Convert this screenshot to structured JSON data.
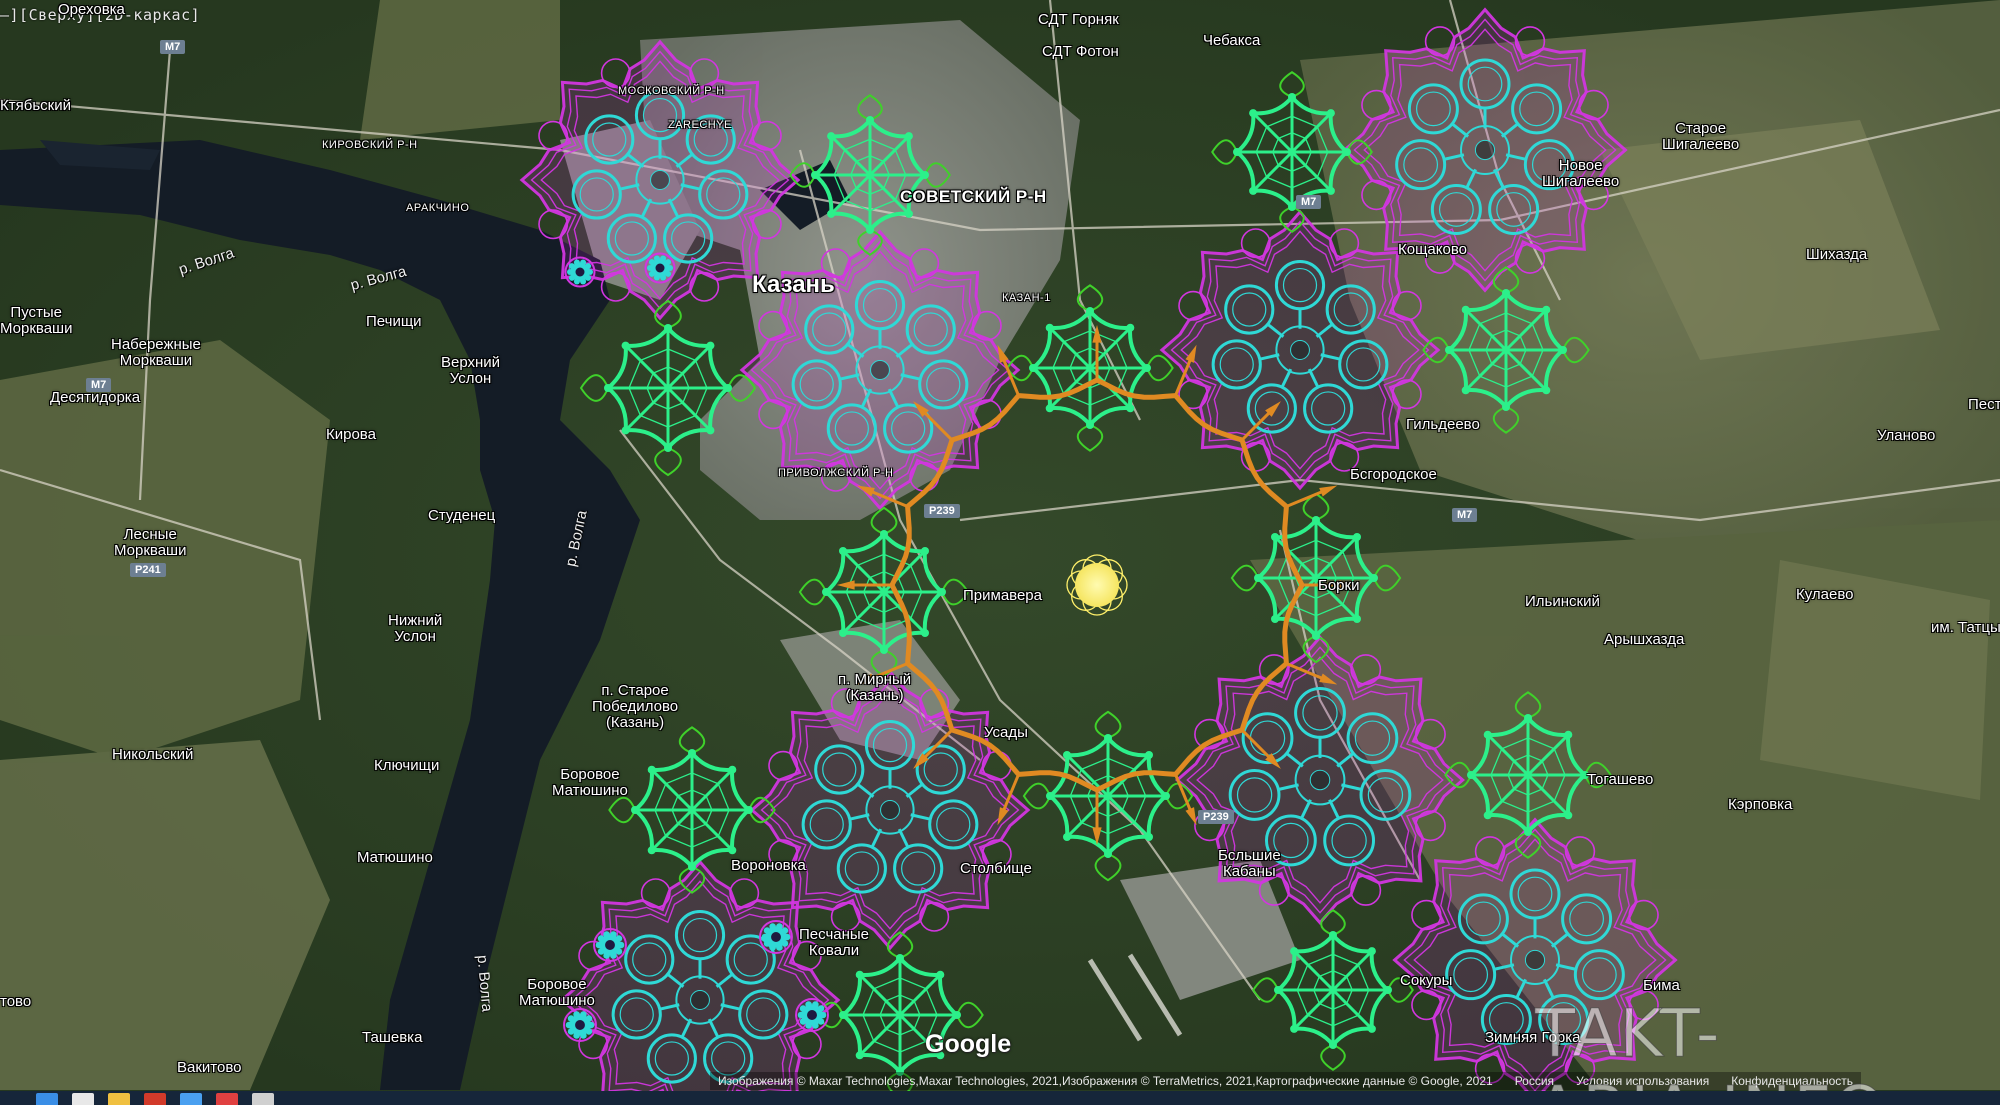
{
  "window": {
    "title": "—][Сверху][2D-каркас]"
  },
  "colors": {
    "water": "#141c26",
    "forest": "#2c4024",
    "field": "#6d7452",
    "urban": "#8b8f8c",
    "magenta": "#d236e0",
    "cyan": "#2fd9d6",
    "green": "#2cf08a",
    "lime": "#3fd12a",
    "orange": "#e08a22",
    "sun": "#fff06a"
  },
  "map": {
    "places": [
      {
        "name": "place-orekhovka",
        "text": "Ореховка"
      },
      {
        "name": "place-kstovo",
        "text": "Ктябьский"
      },
      {
        "name": "place-sdt-gornyak",
        "text": "СДТ Горняк"
      },
      {
        "name": "place-sdt-foton",
        "text": "СДТ Фотон"
      },
      {
        "name": "place-chebaksa",
        "text": "Чебакса"
      },
      {
        "name": "place-moskovsky",
        "text": "МОСКОВСКИЙ Р-Н"
      },
      {
        "name": "place-zarechye",
        "text": "ZARECHYE"
      },
      {
        "name": "place-kirovsky",
        "text": "КИРОВСКИЙ Р-Н"
      },
      {
        "name": "place-arakchino",
        "text": "АРАКЧИНО"
      },
      {
        "name": "place-sovetsky",
        "text": "СОВЕТСКИЙ Р-Н"
      },
      {
        "name": "place-staroe-shigalevo",
        "text": "Старое\nШигалеево"
      },
      {
        "name": "place-novoe-shigalevo",
        "text": "Новое\nШигалеево"
      },
      {
        "name": "place-koshchakovo",
        "text": "Кощаково"
      },
      {
        "name": "place-shikhazda",
        "text": "Шихазда"
      },
      {
        "name": "place-kazan",
        "text": "Казань"
      },
      {
        "name": "place-kazan-1",
        "text": "КАЗАН-1"
      },
      {
        "name": "place-pustye-morkvashi",
        "text": "Пустые\nМоркваши"
      },
      {
        "name": "place-pechishchi",
        "text": "Печищи"
      },
      {
        "name": "place-naberezhnye-morkvashi",
        "text": "Набережные\nМоркваши"
      },
      {
        "name": "place-verkhny-uslon",
        "text": "Верхний\nУслон"
      },
      {
        "name": "place-desyatidorka",
        "text": "Десятидорка"
      },
      {
        "name": "place-kirova",
        "text": "Кирова"
      },
      {
        "name": "place-gildeevo",
        "text": "Гильдеево"
      },
      {
        "name": "place-ulanovo",
        "text": "Уланово"
      },
      {
        "name": "place-pest",
        "text": "Пест"
      },
      {
        "name": "place-privolzhsky",
        "text": "ПРИВОЛЖСКИЙ Р-Н"
      },
      {
        "name": "place-bogorodskoe",
        "text": "Бсгородское"
      },
      {
        "name": "place-studenets",
        "text": "Студенец"
      },
      {
        "name": "place-lesnye-morkvashi",
        "text": "Лесные\nМоркваши"
      },
      {
        "name": "place-primavera",
        "text": "Примавера"
      },
      {
        "name": "place-borki",
        "text": "Борки"
      },
      {
        "name": "place-ilinsky",
        "text": "Ильинский"
      },
      {
        "name": "place-kulaevo",
        "text": "Кулаево"
      },
      {
        "name": "place-tattsy",
        "text": "им. Татцы"
      },
      {
        "name": "place-nizhny-uslon",
        "text": "Нижний\nУслон"
      },
      {
        "name": "place-arysh-khazda",
        "text": "Арышхазда"
      },
      {
        "name": "place-mirny",
        "text": "п. Мирный\n(Казань)"
      },
      {
        "name": "place-staroe-pobedilovo",
        "text": "п. Старое\nПобедилово\n(Казань)"
      },
      {
        "name": "place-usady",
        "text": "Усады"
      },
      {
        "name": "place-nikolsky",
        "text": "Никольский"
      },
      {
        "name": "place-klyuchishchi",
        "text": "Ключищи"
      },
      {
        "name": "place-borovoe-matyushino-1",
        "text": "Боровое\nМатюшино"
      },
      {
        "name": "place-togashevo",
        "text": "Тогашево"
      },
      {
        "name": "place-karpovka",
        "text": "Кэрповка"
      },
      {
        "name": "place-bolshie-kabany",
        "text": "Бсльшие\nКабаны"
      },
      {
        "name": "place-stolbishche",
        "text": "Столбище"
      },
      {
        "name": "place-voronovka",
        "text": "Вороновка"
      },
      {
        "name": "place-matyushino",
        "text": "Матюшино"
      },
      {
        "name": "place-pesчаные-kovali",
        "text": "Песчаные\nКовали"
      },
      {
        "name": "place-borovoe-matyushino-2",
        "text": "Боровое\nМатюшино"
      },
      {
        "name": "place-sokury",
        "text": "Сокуры"
      },
      {
        "name": "place-bima",
        "text": "Бима"
      },
      {
        "name": "place-tovo",
        "text": "тово"
      },
      {
        "name": "place-tashevka",
        "text": "Ташевка"
      },
      {
        "name": "place-vakitovo",
        "text": "Вакитово"
      },
      {
        "name": "place-zimnyaya-gorka",
        "text": "Зимняя Горка"
      }
    ],
    "rivers": [
      {
        "name": "river-label-1",
        "text": "р. Волга"
      },
      {
        "name": "river-label-2",
        "text": "р. Волга"
      },
      {
        "name": "river-label-3",
        "text": "р. Волга"
      },
      {
        "name": "river-label-4",
        "text": "р. Волга"
      }
    ],
    "roads": [
      {
        "name": "road-m7-north",
        "text": "M7"
      },
      {
        "name": "road-m7-west",
        "text": "M7"
      },
      {
        "name": "road-m7-center",
        "text": "M7"
      },
      {
        "name": "road-m7-east",
        "text": "M7"
      },
      {
        "name": "road-p241",
        "text": "P241"
      },
      {
        "name": "road-p239-a",
        "text": "P239"
      },
      {
        "name": "road-p239-b",
        "text": "P239"
      }
    ],
    "google_logo": "Google",
    "attribution": [
      "Изображения © Maxar Technologies,Maxar Technologies, 2021,Изображения © TerraMetrics, 2021,Картографические данные © Google, 2021",
      "Россия",
      "Условия использования",
      "Конфиденциальность"
    ],
    "watermark": "TAKT-ARIA.INFO"
  }
}
